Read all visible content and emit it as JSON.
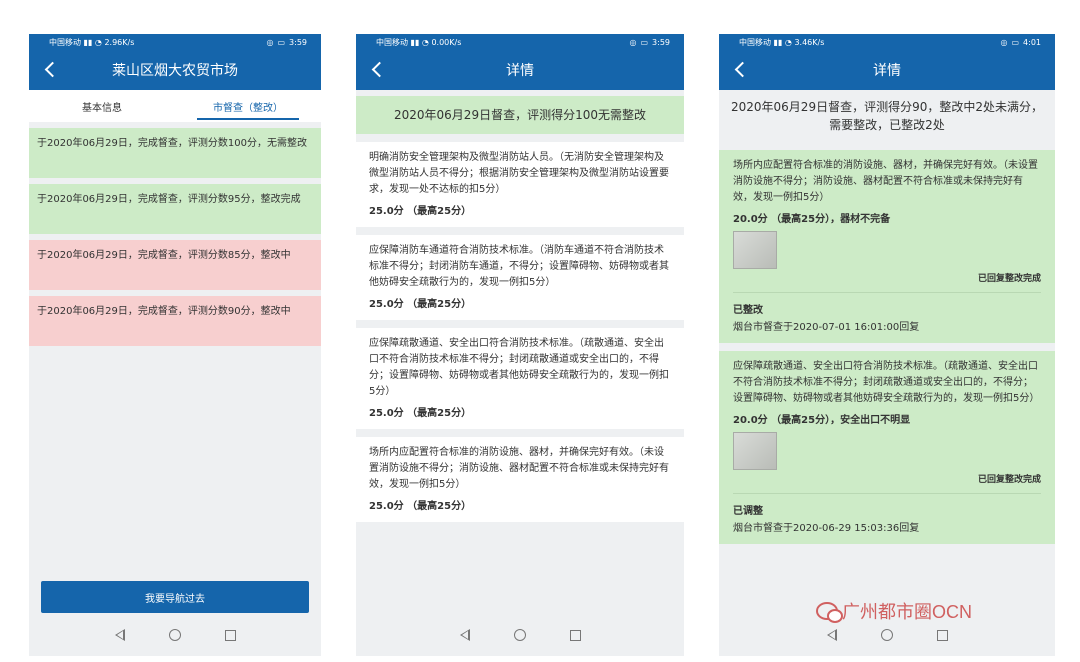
{
  "screen1": {
    "status": {
      "carrier": "中国移动",
      "speed": "2.96K/s",
      "time": "3:59"
    },
    "title": "莱山区烟大农贸市场",
    "tabs": [
      "基本信息",
      "市督查（整改）"
    ],
    "records": [
      {
        "text": "于2020年06月29日，完成督查，评测分数100分，无需整改",
        "color": "#cdebc7"
      },
      {
        "text": "于2020年06月29日，完成督查，评测分数95分，整改完成",
        "color": "#cdebc7"
      },
      {
        "text": "于2020年06月29日，完成督查，评测分数85分，整改中",
        "color": "#f7cfcf"
      },
      {
        "text": "于2020年06月29日，完成督查，评测分数90分，整改中",
        "color": "#f7cfcf"
      }
    ],
    "nav_button": "我要导航过去"
  },
  "screen2": {
    "status": {
      "carrier": "中国移动",
      "speed": "0.00K/s",
      "time": "3:59"
    },
    "title": "详情",
    "banner": "2020年06月29日督查，评测得分100无需整改",
    "items": [
      {
        "text": "明确消防安全管理架构及微型消防站人员。（无消防安全管理架构及微型消防站人员不得分；根据消防安全管理架构及微型消防站设置要求，发现一处不达标的扣5分）",
        "score": "25.0分 （最高25分）"
      },
      {
        "text": "应保障消防车通道符合消防技术标准。（消防车通道不符合消防技术标准不得分；封闭消防车通道，不得分；设置障碍物、妨碍物或者其他妨碍安全疏散行为的，发现一例扣5分）",
        "score": "25.0分 （最高25分）"
      },
      {
        "text": "应保障疏散通道、安全出口符合消防技术标准。（疏散通道、安全出口不符合消防技术标准不得分；封闭疏散通道或安全出口的，不得分；设置障碍物、妨碍物或者其他妨碍安全疏散行为的，发现一例扣5分）",
        "score": "25.0分 （最高25分）"
      },
      {
        "text": "场所内应配置符合标准的消防设施、器材，并确保完好有效。（未设置消防设施不得分；消防设施、器材配置不符合标准或未保持完好有效，发现一例扣5分）",
        "score": "25.0分 （最高25分）"
      }
    ]
  },
  "screen3": {
    "status": {
      "carrier": "中国移动",
      "speed": "3.46K/s",
      "time": "4:01"
    },
    "title": "详情",
    "banner": "2020年06月29日督查，评测得分90，整改中2处未满分，需要整改，已整改2处",
    "items": [
      {
        "text": "场所内应配置符合标准的消防设施、器材，并确保完好有效。（未设置消防设施不得分；消防设施、器材配置不符合标准或未保持完好有效，发现一例扣5分）",
        "score": "20.0分 （最高25分），器材不完备",
        "done": "已回复整改完成",
        "reply_status": "已整改",
        "reply_text": "烟台市督查于2020-07-01 16:01:00回复"
      },
      {
        "text": "应保障疏散通道、安全出口符合消防技术标准。（疏散通道、安全出口不符合消防技术标准不得分；封闭疏散通道或安全出口的，不得分；设置障碍物、妨碍物或者其他妨碍安全疏散行为的，发现一例扣5分）",
        "score": "20.0分 （最高25分），安全出口不明显",
        "done": "已回复整改完成",
        "reply_status": "已调整",
        "reply_text": "烟台市督查于2020-06-29 15:03:36回复"
      }
    ]
  },
  "watermark": "广州都市圈OCN"
}
